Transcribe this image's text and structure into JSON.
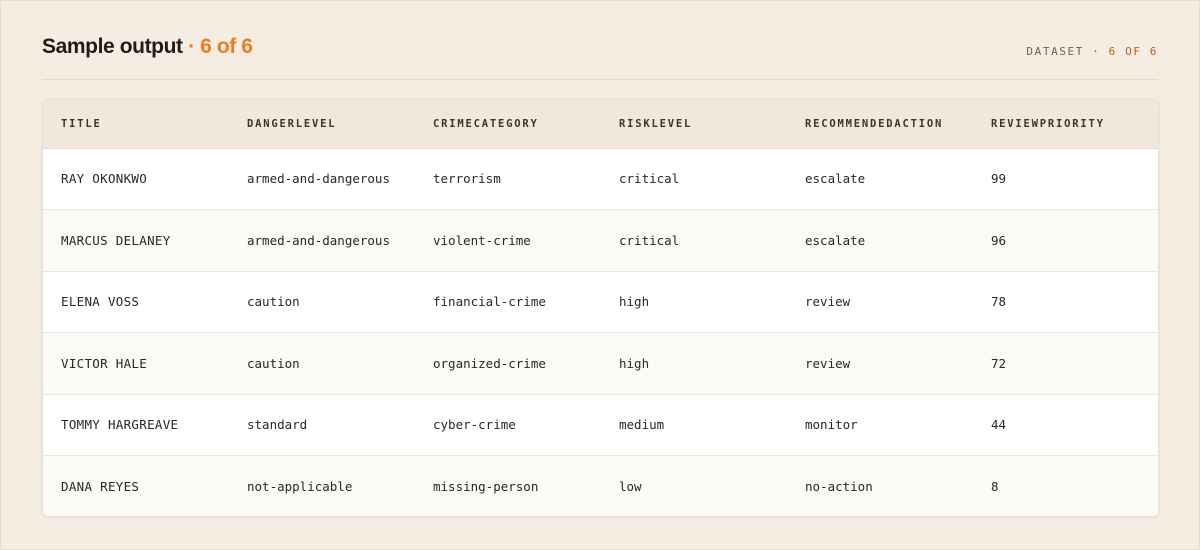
{
  "header": {
    "title": "Sample output",
    "separator": " · ",
    "count": "6 of 6",
    "dataset_label": "DATASET",
    "dataset_separator": " · ",
    "dataset_count": "6 OF 6"
  },
  "table": {
    "columns": [
      "TITLE",
      "DANGERLEVEL",
      "CRIMECATEGORY",
      "RISKLEVEL",
      "RECOMMENDEDACTION",
      "REVIEWPRIORITY"
    ],
    "rows": [
      [
        "RAY OKONKWO",
        "armed-and-dangerous",
        "terrorism",
        "critical",
        "escalate",
        "99"
      ],
      [
        "MARCUS DELANEY",
        "armed-and-dangerous",
        "violent-crime",
        "critical",
        "escalate",
        "96"
      ],
      [
        "ELENA VOSS",
        "caution",
        "financial-crime",
        "high",
        "review",
        "78"
      ],
      [
        "VICTOR HALE",
        "caution",
        "organized-crime",
        "high",
        "review",
        "72"
      ],
      [
        "TOMMY HARGREAVE",
        "standard",
        "cyber-crime",
        "medium",
        "monitor",
        "44"
      ],
      [
        "DANA REYES",
        "not-applicable",
        "missing-person",
        "low",
        "no-action",
        "8"
      ]
    ]
  },
  "colors": {
    "accent": "#f07b1f",
    "background": "#f5ede2",
    "header_row": "#f1e8dc"
  }
}
